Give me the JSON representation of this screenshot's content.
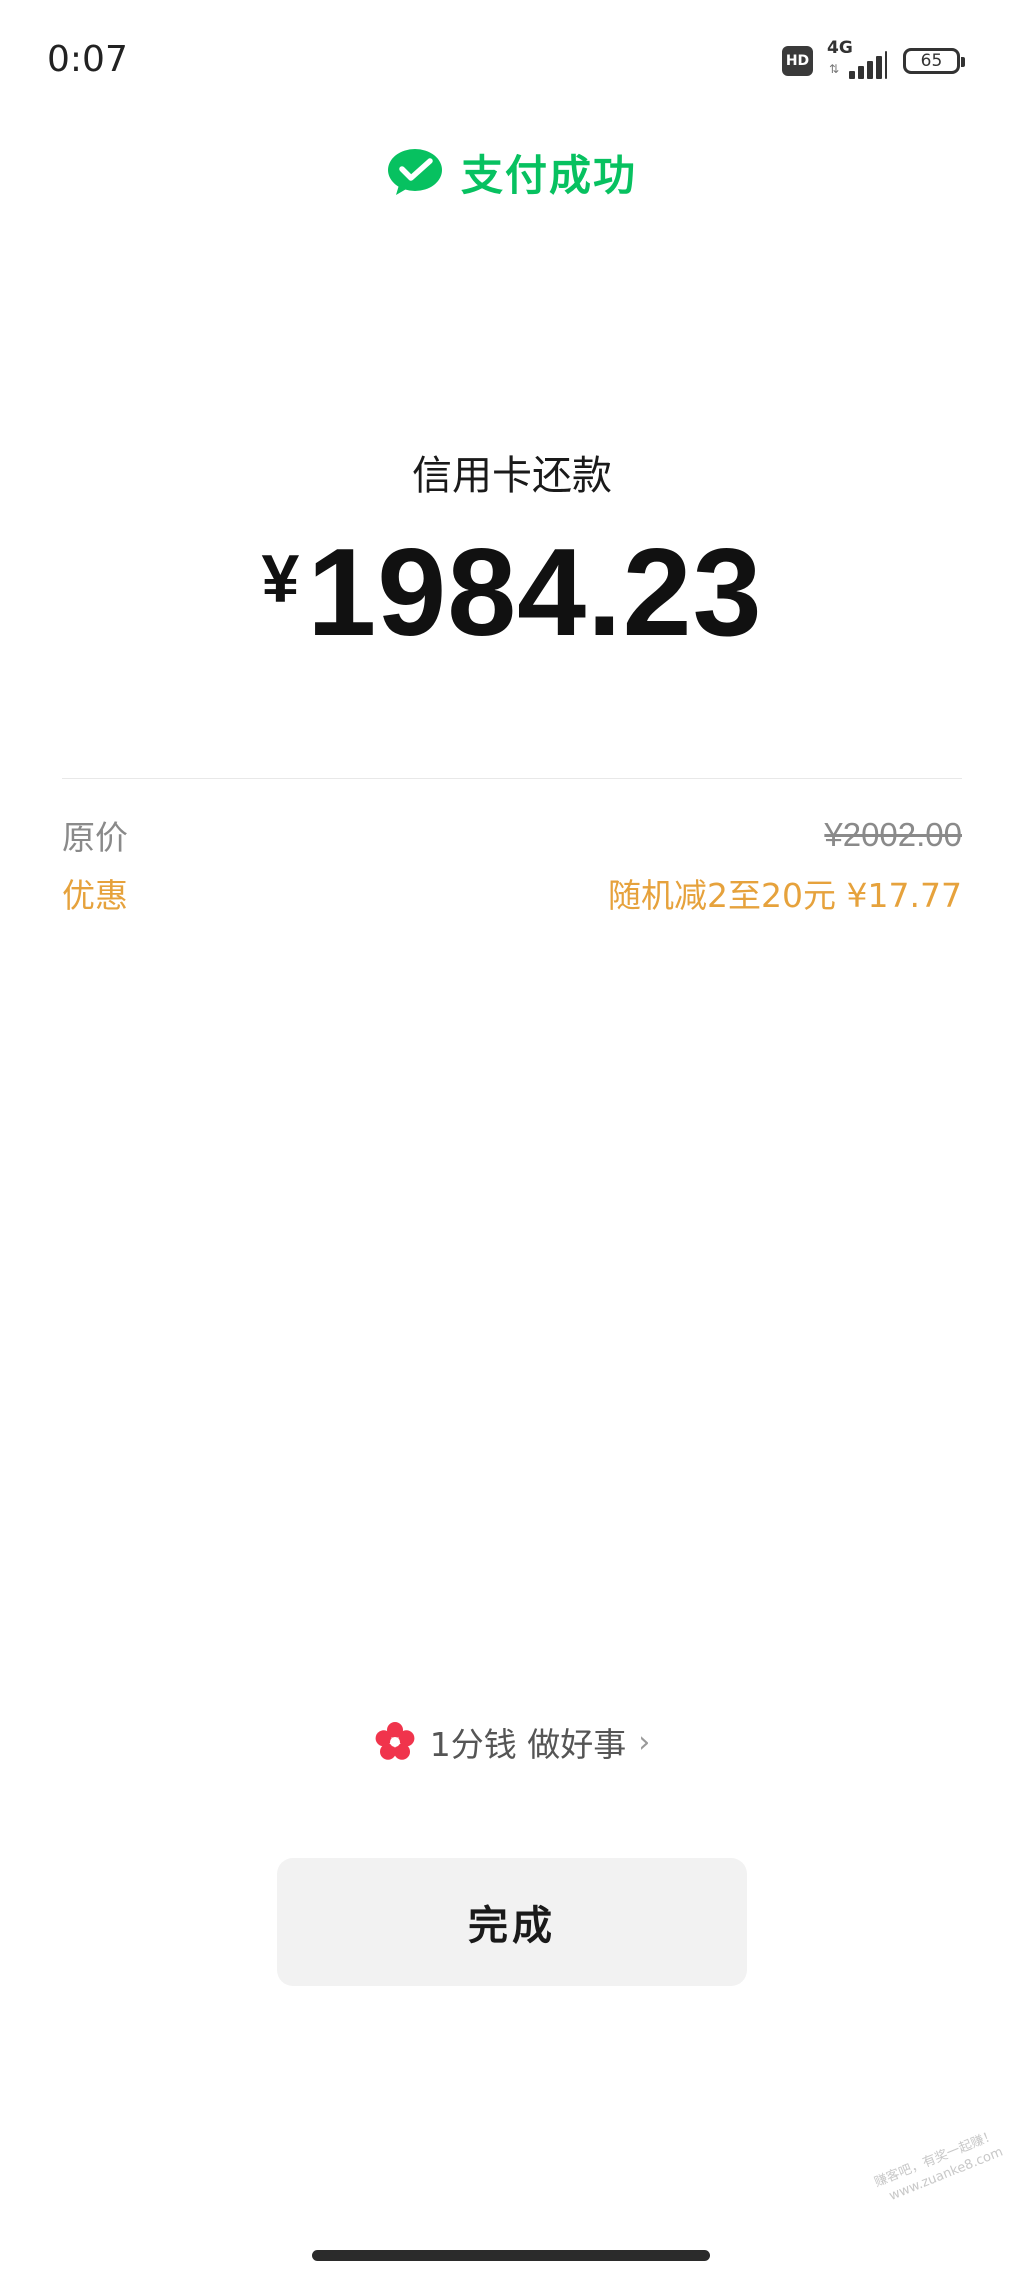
{
  "status_bar": {
    "time": "0:07",
    "hd": "HD",
    "network": "4G",
    "network_arrows": "⇅",
    "battery": "65"
  },
  "header": {
    "title": "支付成功",
    "brand_color": "#07c160"
  },
  "payment": {
    "merchant": "信用卡还款",
    "currency": "¥",
    "amount": "1984.23"
  },
  "price_details": {
    "original_label": "原价",
    "original_value": "¥2002.00",
    "discount_label": "优惠",
    "discount_value": "随机减2至20元 ¥17.77",
    "discount_color": "#e6a23c"
  },
  "donate": {
    "label": "1分钱 做好事",
    "chevron": "›"
  },
  "actions": {
    "done_label": "完成"
  },
  "watermark": {
    "line1": "赚客吧，有奖一起赚！",
    "line2": "www.zuanke8.com"
  }
}
